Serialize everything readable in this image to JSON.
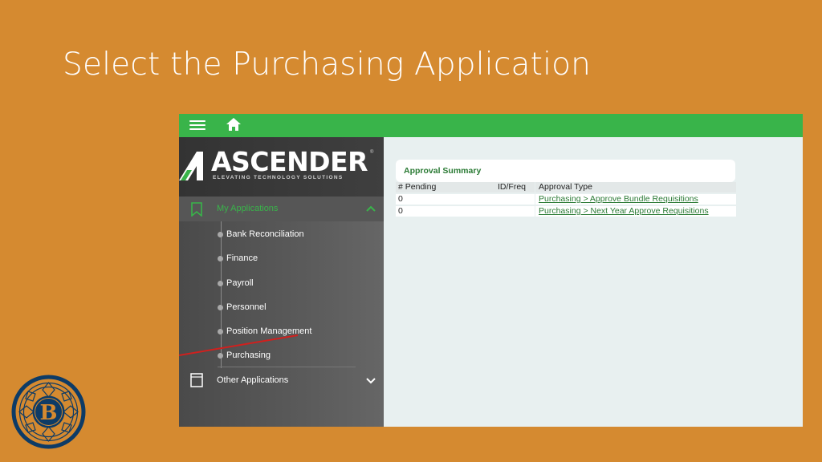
{
  "slide": {
    "title": "Select the Purchasing Application"
  },
  "app": {
    "brand": {
      "name": "ASCENDER",
      "registered_mark": "®",
      "tagline": "ELEVATING TECHNOLOGY SOLUTIONS"
    },
    "topbar": {
      "menu_icon": "hamburger-icon",
      "home_icon": "home-icon",
      "color": "#39b44a"
    },
    "sidebar": {
      "my_applications_label": "My Applications",
      "other_applications_label": "Other Applications",
      "items": [
        {
          "label": "Bank Reconciliation"
        },
        {
          "label": "Finance"
        },
        {
          "label": "Payroll"
        },
        {
          "label": "Personnel"
        },
        {
          "label": "Position Management"
        },
        {
          "label": "Purchasing"
        }
      ]
    },
    "approval_summary": {
      "title": "Approval Summary",
      "columns": [
        "# Pending",
        "ID/Freq",
        "Approval Type"
      ],
      "rows": [
        {
          "pending": "0",
          "id_freq": "",
          "approval_type": "Purchasing > Approve Bundle Requisitions"
        },
        {
          "pending": "0",
          "id_freq": "",
          "approval_type": "Purchasing > Next Year Approve Requisitions"
        }
      ]
    }
  },
  "seal": {
    "letter": "B",
    "colors": {
      "ring": "#0d3b66",
      "fill": "#d58a30"
    }
  }
}
